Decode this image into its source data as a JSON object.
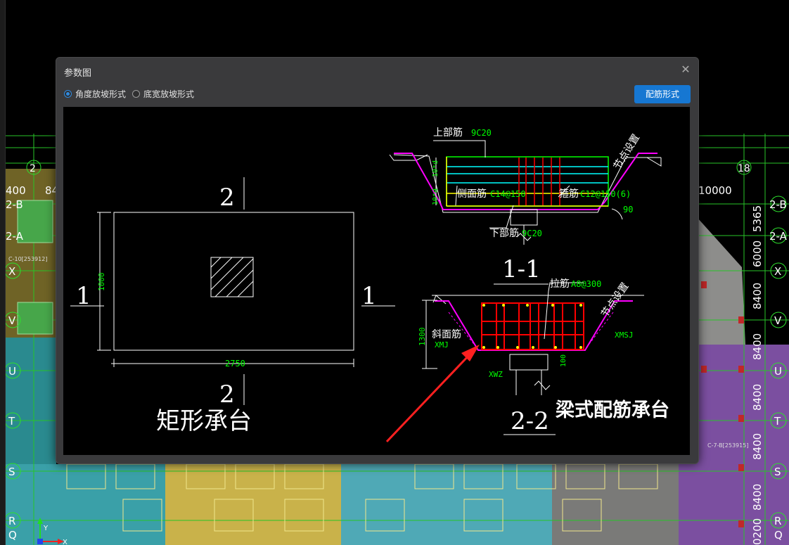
{
  "background": {
    "grid_left": [
      "2",
      "400",
      "84",
      "2-B",
      "2-A",
      "C-10[253912]",
      "X",
      "V",
      "U",
      "T",
      "S",
      "R",
      "Q"
    ],
    "grid_right": [
      "18",
      "10000",
      "5365",
      "2-B",
      "2-A",
      "6000",
      "X",
      "8400",
      "V",
      "8400",
      "U",
      "8400",
      "T",
      "8400",
      "S",
      "8400",
      "R",
      "0200",
      "Q",
      "C-7-B[253915]"
    ],
    "ucs_y": "Y",
    "ucs_x": "X"
  },
  "dialog": {
    "title": "参数图",
    "close_symbol": "✕",
    "options": [
      {
        "label": "角度放坡形式",
        "checked": true
      },
      {
        "label": "底宽放坡形式",
        "checked": false
      }
    ],
    "rebar_button": "配筋形式"
  },
  "drawing": {
    "rect": {
      "top_label": "2",
      "bottom_label": "2",
      "left_label": "1",
      "right_label": "1",
      "height_dim": "1000",
      "width_dim": "2750",
      "caption": "矩形承台"
    },
    "section11": {
      "top_rebar_label": "上部筋",
      "top_rebar_value": "9C20",
      "side_rebar_label": "侧面筋",
      "side_rebar_value": "C14@150",
      "stirrup_label": "箍筋",
      "stirrup_value": "C12@150(6)",
      "bottom_rebar_label": "下部筋",
      "bottom_rebar_value": "9C20",
      "dim_10d_a": "10*d",
      "dim_10d_b": "10*d",
      "node_label": "节点设置",
      "angle": "90",
      "title": "1-1"
    },
    "section22": {
      "tie_label": "拉筋",
      "tie_value": "A8@300",
      "slope_label": "斜面筋",
      "xmj": "XMJ",
      "xmsj": "XMSJ",
      "xwz": "XWZ",
      "height_dim": "1300",
      "dim_100": "100",
      "node_label": "节点设置",
      "title": "2-2"
    },
    "annotation": "梁式配筋承台"
  },
  "colors": {
    "accent": "#1677d2",
    "cad_green": "#00ff00",
    "cad_magenta": "#ff00ff",
    "cad_red": "#ff0000",
    "cad_yellow": "#ffff00",
    "cad_cyan": "#00ffff",
    "arrow_red": "#ff2020"
  }
}
